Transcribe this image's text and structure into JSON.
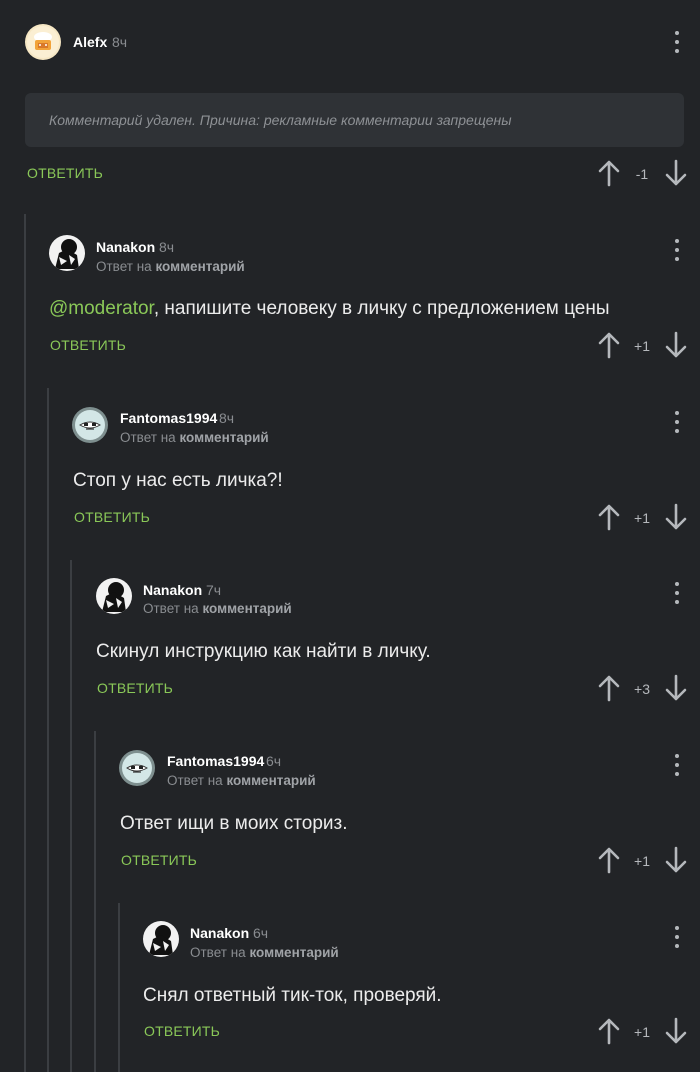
{
  "comments": [
    {
      "author": "Alefx",
      "time": "8ч",
      "deleted_notice": "Комментарий удален. Причина: рекламные комментарии запрещены",
      "reply_label": "ОТВЕТИТЬ",
      "rating": "-1",
      "avatar": "avatar-chef"
    },
    {
      "author": "Nanakon",
      "time": "8ч",
      "reply_to_prefix": "Ответ на",
      "reply_to_link": "комментарий",
      "mention": "@moderator",
      "text": ", напишите человеку в личку с предложением цены",
      "reply_label": "ОТВЕТИТЬ",
      "rating": "+1",
      "avatar": "avatar-bw"
    },
    {
      "author": "Fantomas1994",
      "time": "8ч",
      "reply_to_prefix": "Ответ на",
      "reply_to_link": "комментарий",
      "text": "Стоп у нас есть личка?!",
      "reply_label": "ОТВЕТИТЬ",
      "rating": "+1",
      "avatar": "avatar-mask"
    },
    {
      "author": "Nanakon",
      "time": "7ч",
      "reply_to_prefix": "Ответ на",
      "reply_to_link": "комментарий",
      "text": "Скинул инструкцию как найти в личку.",
      "reply_label": "ОТВЕТИТЬ",
      "rating": "+3",
      "avatar": "avatar-bw"
    },
    {
      "author": "Fantomas1994",
      "time": "6ч",
      "reply_to_prefix": "Ответ на",
      "reply_to_link": "комментарий",
      "text": "Ответ ищи в моих сториз.",
      "reply_label": "ОТВЕТИТЬ",
      "rating": "+1",
      "avatar": "avatar-mask"
    },
    {
      "author": "Nanakon",
      "time": "6ч",
      "reply_to_prefix": "Ответ на",
      "reply_to_link": "комментарий",
      "text": "Снял ответный тик-ток, проверяй.",
      "reply_label": "ОТВЕТИТЬ",
      "rating": "+1",
      "avatar": "avatar-bw"
    }
  ],
  "colors": {
    "background": "#222427",
    "accent_green": "#8ac858",
    "muted_text": "#8a8d91",
    "thread_line": "#3b3e42"
  },
  "icons": [
    "more-vertical-icon",
    "arrow-up-icon",
    "arrow-down-icon"
  ]
}
